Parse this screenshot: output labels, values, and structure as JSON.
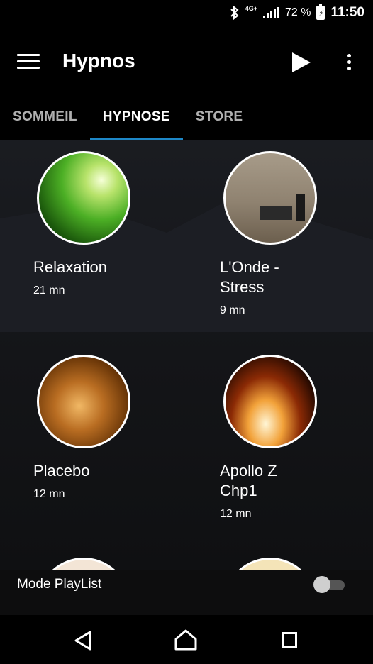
{
  "status": {
    "network": "4G+",
    "battery": "72 %",
    "time": "11:50"
  },
  "appbar": {
    "title": "Hypnos"
  },
  "tabs": [
    {
      "label": "SOMMEIL",
      "active": false
    },
    {
      "label": "HYPNOSE",
      "active": true
    },
    {
      "label": "STORE",
      "active": false
    }
  ],
  "accent_color": "#1e88c8",
  "items": [
    {
      "name": "Relaxation",
      "duration": "21 mn"
    },
    {
      "name": "L'Onde - Stress",
      "duration": "9 mn"
    },
    {
      "name": "Placebo",
      "duration": "12 mn"
    },
    {
      "name": "Apollo Z Chp1",
      "duration": "12 mn"
    }
  ],
  "playlist": {
    "label": "Mode PlayList",
    "enabled": false
  },
  "icons": [
    "menu-icon",
    "play-icon",
    "more-vert-icon",
    "bluetooth-icon",
    "signal-icon",
    "battery-icon",
    "back-icon",
    "home-icon",
    "recents-icon"
  ]
}
